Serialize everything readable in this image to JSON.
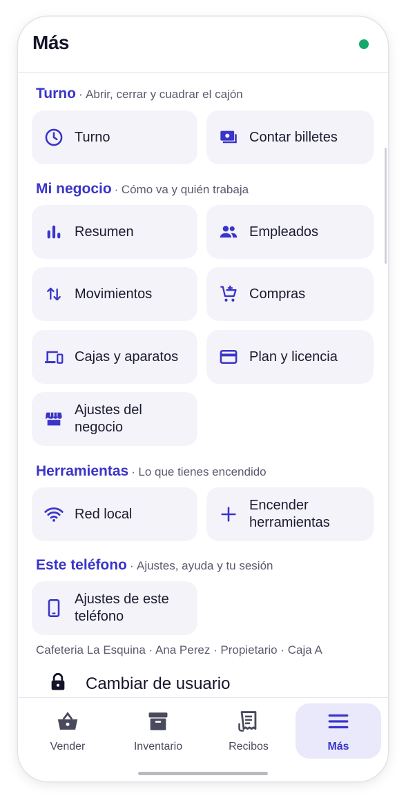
{
  "header": {
    "title": "Más"
  },
  "sections": {
    "turno": {
      "title": "Turno",
      "separator": "·",
      "subtitle": "Abrir, cerrar y cuadrar el cajón"
    },
    "negocio": {
      "title": "Mi negocio",
      "separator": "·",
      "subtitle": "Cómo va y quién trabaja"
    },
    "herramientas": {
      "title": "Herramientas",
      "separator": "·",
      "subtitle": "Lo que tienes encendido"
    },
    "telefono": {
      "title": "Este teléfono",
      "separator": "·",
      "subtitle": "Ajustes, ayuda y tu sesión"
    }
  },
  "tiles": {
    "turno": "Turno",
    "contar_billetes": "Contar billetes",
    "resumen": "Resumen",
    "empleados": "Empleados",
    "movimientos": "Movimientos",
    "compras": "Compras",
    "cajas_aparatos": "Cajas y aparatos",
    "plan_licencia": "Plan y licencia",
    "ajustes_negocio": "Ajustes del negocio",
    "red_local": "Red local",
    "encender_herramientas": "Encender herramientas",
    "ajustes_telefono": "Ajustes de este teléfono"
  },
  "footer": {
    "info": "Cafeteria La Esquina · Ana Perez · Propietario · Caja A",
    "switch_user": "Cambiar de usuario"
  },
  "nav": {
    "vender": "Vender",
    "inventario": "Inventario",
    "recibos": "Recibos",
    "mas": "Más",
    "active": "Más"
  },
  "colors": {
    "accent": "#3a34c9",
    "status_online": "#12a86a",
    "tile_bg": "#f3f3f9",
    "nav_active_bg": "#e9e9fb"
  }
}
